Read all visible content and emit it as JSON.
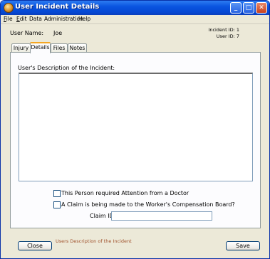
{
  "window": {
    "title": "User Incident Details",
    "accent": "#0548d4"
  },
  "titlebar_buttons": {
    "minimize": "_",
    "maximize": "□",
    "close": "✕"
  },
  "menu": [
    {
      "underline": "F",
      "rest": "ile"
    },
    {
      "underline": "E",
      "rest": "dit"
    },
    {
      "underline": "",
      "rest": "Data"
    },
    {
      "underline": "",
      "rest": "Administration"
    },
    {
      "underline": "",
      "rest": "Help"
    }
  ],
  "header": {
    "user_name_label": "User Name:",
    "user_name_value": "Joe",
    "incident_id_text": "Incident ID: 1",
    "user_id_text": "User ID: 7"
  },
  "tabs": [
    {
      "label": "Injury",
      "active": false
    },
    {
      "label": "Details",
      "active": true
    },
    {
      "label": "Files",
      "active": false
    },
    {
      "label": "Notes",
      "active": false
    }
  ],
  "details": {
    "description_label": "User's Description of the Incident:",
    "description_value": "",
    "doctor_checkbox_label": "This Person required Attention from a Doctor",
    "doctor_checked": false,
    "claim_checkbox_label": "A Claim is being made to the Worker's Compensation Board?",
    "claim_checked": false,
    "claim_id_label": "Claim ID:",
    "claim_id_value": ""
  },
  "footer": {
    "close_label": "Close",
    "save_label": "Save",
    "status_text": "Users Description of the Incident"
  }
}
